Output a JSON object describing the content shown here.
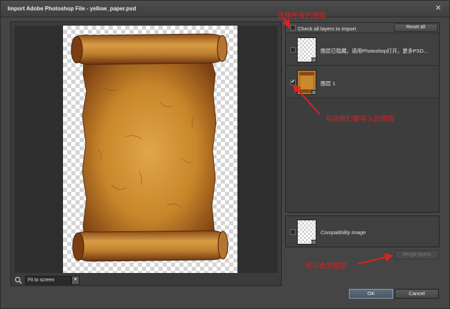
{
  "window": {
    "title": "Import Adobe Photoshop File - yellow_paper.psd",
    "close_glyph": "✕"
  },
  "preview": {
    "zoom_icon": "zoom-icon",
    "fit_value": "Fit to screen",
    "dropdown_icon": "chevron-down-icon"
  },
  "layers": {
    "check_all_label": "Check all layers to import",
    "reset_label": "Reset all",
    "rows": [
      {
        "label": "图层已隐藏。请用Photoshop打开。更多PSD...",
        "checked": false
      },
      {
        "label": "图层 1",
        "checked": true,
        "check_glyph": "✔"
      }
    ],
    "compat_label": "Compatibility image",
    "merge_label": "Merge layers"
  },
  "buttons": {
    "ok": "OK",
    "cancel": "Cancel"
  },
  "annotations": {
    "select_all": "选择所有的图层",
    "layer_to_import": "勾选我们要导入的图层",
    "merge": "可以合并图层",
    "color": "#e02020"
  },
  "colors": {
    "dialog_bg": "#454545",
    "panel_bg": "#3d3d3d",
    "parchment": "#c98a2e"
  }
}
